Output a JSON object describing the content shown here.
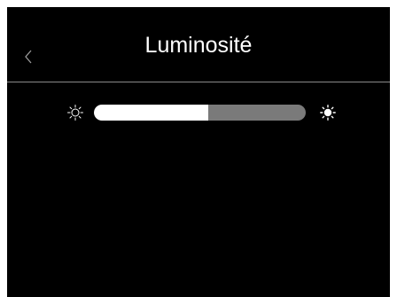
{
  "header": {
    "back_icon": "chevron-left-icon",
    "title": "Luminosité"
  },
  "brightness": {
    "level": 0.54,
    "low_icon": "sun-outline-icon",
    "high_icon": "sun-filled-icon",
    "colors": {
      "fill": "#ffffff",
      "track": "#7a7a7a"
    }
  },
  "colors": {
    "background": "#000000",
    "divider": "#8a8a8a",
    "text": "#ffffff"
  }
}
